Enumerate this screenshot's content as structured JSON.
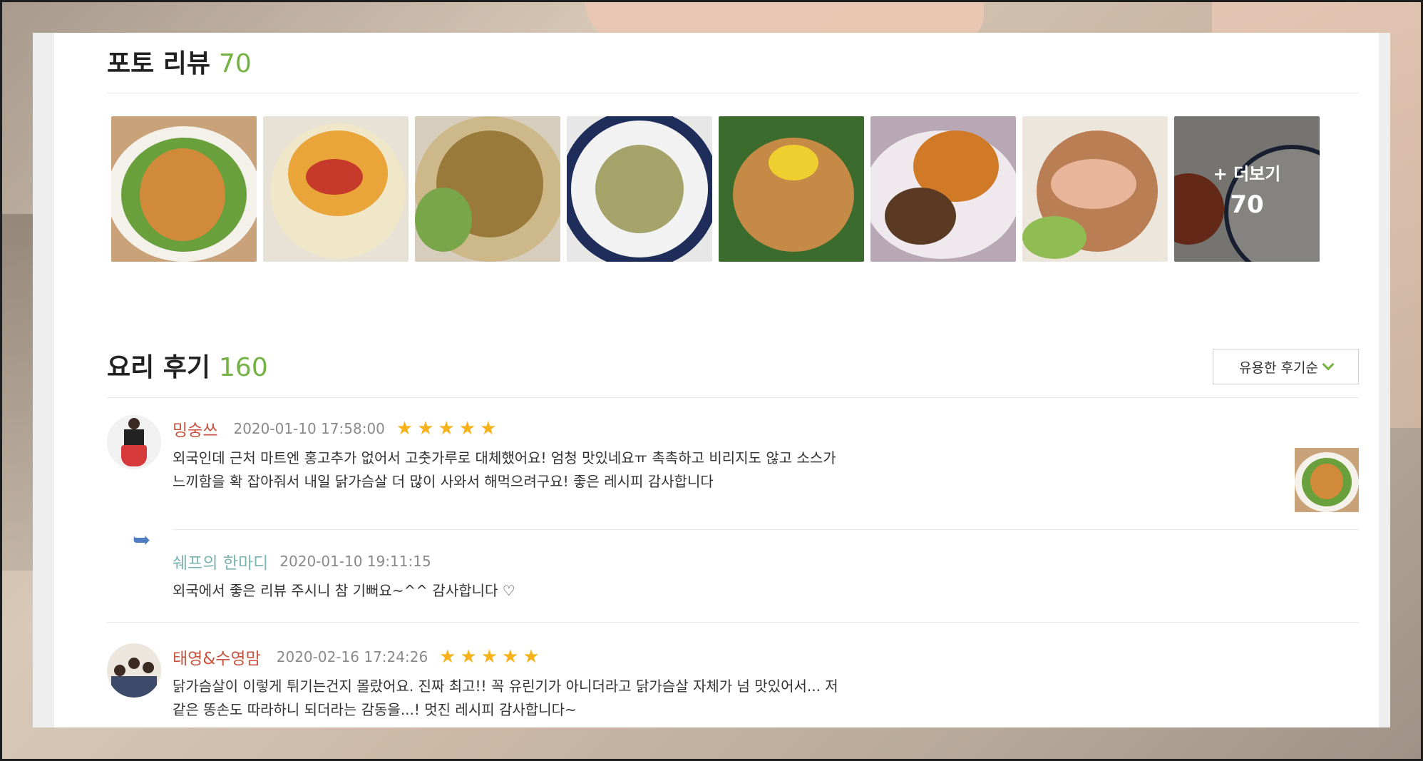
{
  "photo_reviews": {
    "title": "포토 리뷰",
    "count": "70",
    "thumbnails": [
      {
        "icon": "salad-photo-1"
      },
      {
        "icon": "salad-photo-2"
      },
      {
        "icon": "salad-photo-3"
      },
      {
        "icon": "salad-photo-4"
      },
      {
        "icon": "salad-photo-5"
      },
      {
        "icon": "salad-photo-6"
      },
      {
        "icon": "salad-photo-7"
      }
    ],
    "more": {
      "label": "+ 더보기",
      "count": "70"
    }
  },
  "cook_reviews": {
    "title": "요리 후기",
    "count": "160",
    "sort_label": "유용한 후기순",
    "items": [
      {
        "name": "밍숭쓰",
        "date": "2020-01-10 17:58:00",
        "rating": 5,
        "text_line1": "외국인데 근처 마트엔 홍고추가 없어서 고춧가루로 대체했어요! 엄청 맛있네요ㅠ 촉촉하고 비리지도 않고 소스가",
        "text_line2": "느끼함을 확 잡아줘서 내일 닭가슴살 더 많이 사와서 해먹으려구요! 좋은 레시피 감사합니다",
        "reply": {
          "name": "쉐프의 한마디",
          "date": "2020-01-10 19:11:15",
          "text": "외국에서 좋은 리뷰 주시니 참 기뻐요~^^ 감사합니다 ♡"
        }
      },
      {
        "name": "태영&수영맘",
        "date": "2020-02-16 17:24:26",
        "rating": 5,
        "text_line1": "닭가슴살이 이렇게 튀기는건지 몰랐어요. 진짜 최고!! 꼭 유린기가 아니더라고 닭가슴살 자체가 넘 맛있어서... 저",
        "text_line2": "같은 똥손도 따라하니 되더라는 감동을...! 멋진 레시피 감사합니다~"
      }
    ]
  },
  "colors": {
    "accent": "#74b243",
    "reviewer": "#c8543f",
    "chef": "#7ab3b0",
    "star": "#f5b21b"
  }
}
